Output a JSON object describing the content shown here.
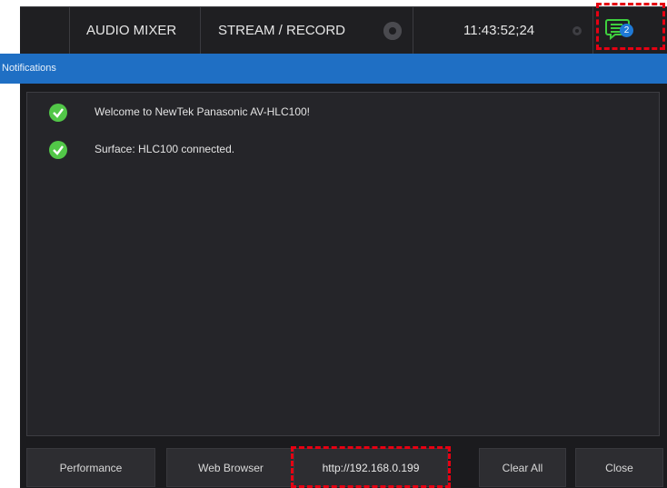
{
  "topbar": {
    "audio_mixer": "AUDIO MIXER",
    "stream_record": "STREAM / RECORD",
    "clock": "11:43:52;24",
    "notification_count": "2"
  },
  "notifications": {
    "title": "Notifications",
    "items": [
      {
        "text": "Welcome to NewTek Panasonic AV-HLC100!",
        "status": "success"
      },
      {
        "text": "Surface: HLC100 connected.",
        "status": "success"
      }
    ]
  },
  "footer": {
    "performance": "Performance",
    "web_browser": "Web Browser",
    "url": "http://192.168.0.199",
    "clear_all": "Clear All",
    "close": "Close"
  },
  "colors": {
    "accent": "#1f6fc4",
    "success": "#52c748",
    "notification_icon": "#3ecf3e",
    "highlight": "#e60012"
  }
}
